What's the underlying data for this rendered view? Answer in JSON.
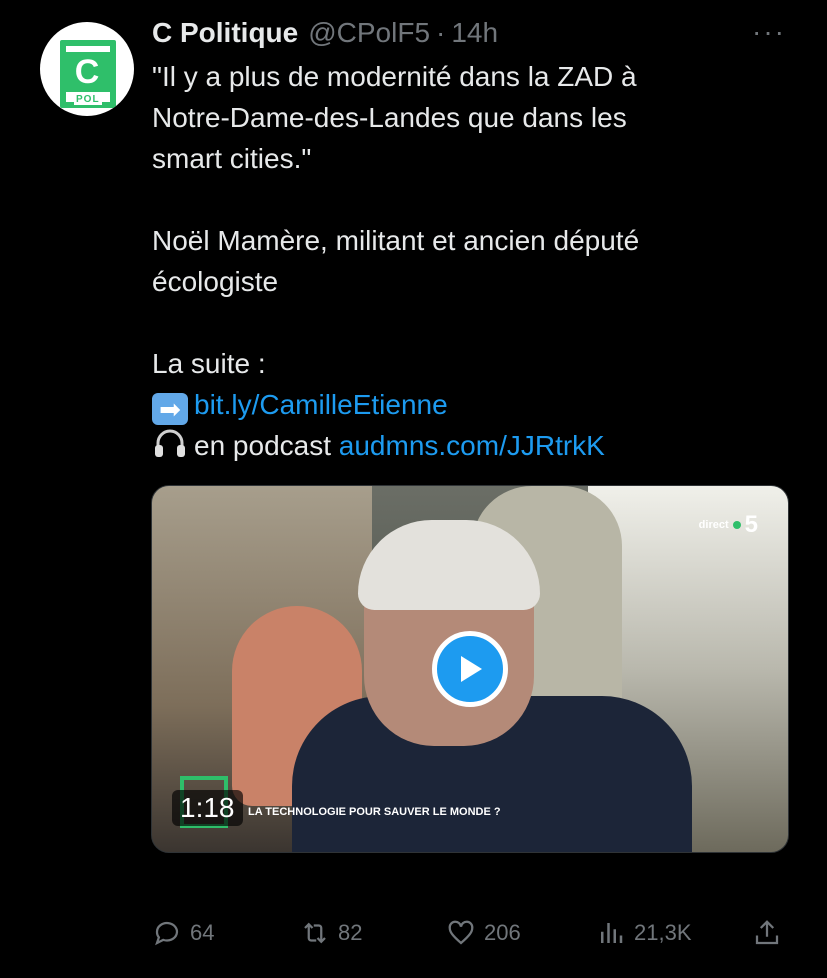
{
  "tweet": {
    "author_name": "C Politique",
    "handle": "@CPolF5",
    "separator": "·",
    "time": "14h",
    "more": "···",
    "avatar": {
      "logo_letter": "C",
      "logo_text": "POL",
      "brand_color": "#2fbf6a"
    },
    "text": {
      "line1": "\"Il y a plus de modernité dans la ZAD à",
      "line2": "Notre-Dame-des-Landes que dans les",
      "line3": "smart cities.\"",
      "line4": "Noël Mamère, militant et ancien député",
      "line5": "écologiste",
      "line6": "La suite :",
      "link1": "bit.ly/CamilleEtienne",
      "podcast_prefix": "en podcast",
      "link2": "audmns.com/JJRtrkK"
    },
    "video": {
      "duration": "1:18",
      "chyron_prefix": "LA TECHNOLOGIE POUR ",
      "chyron_bold": "SAUVER LE MONDE ?",
      "channel_label": "direct",
      "channel_number": "5",
      "play_color": "#1d9bf0"
    },
    "stats": {
      "replies": "64",
      "reposts": "82",
      "likes": "206",
      "views": "21,3K"
    }
  },
  "colors": {
    "background": "#000000",
    "text": "#e7e9ea",
    "muted": "#71767b",
    "link": "#1d9bf0"
  }
}
